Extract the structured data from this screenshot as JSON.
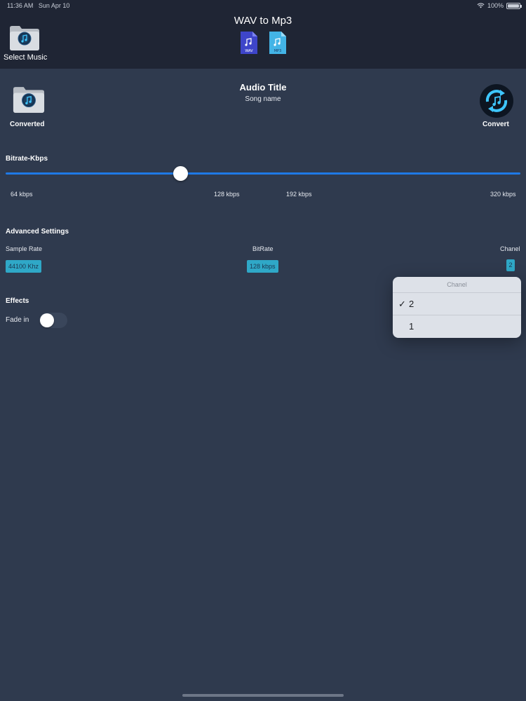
{
  "status_bar": {
    "time": "11:36 AM",
    "date": "Sun Apr 10",
    "battery": "100%",
    "wifi_icon": "wifi-icon",
    "battery_icon": "battery-icon"
  },
  "header": {
    "title": "WAV to Mp3",
    "select_music_label": "Select Music",
    "wav_icon_label": "WAV",
    "mp3_icon_label": "MP3"
  },
  "audio": {
    "title": "Audio Title",
    "song_name": "Song name"
  },
  "actions": {
    "converted_label": "Converted",
    "convert_label": "Convert"
  },
  "bitrate": {
    "title": "Bitrate-Kbps",
    "ticks": [
      "64 kbps",
      "128 kbps",
      "192 kbps",
      "320 kbps"
    ],
    "slider_fraction": 0.34
  },
  "advanced": {
    "title": "Advanced Settings",
    "sample_rate_label": "Sample Rate",
    "sample_rate_value": "44100 Khz",
    "bitrate_label": "BitRate",
    "bitrate_value": "128 kbps",
    "chanel_label": "Chanel",
    "chanel_value": "2"
  },
  "effects": {
    "title": "Effects",
    "fade_in_label": "Fade in",
    "fade_in_on": false
  },
  "chanel_menu": {
    "title": "Chanel",
    "options": [
      {
        "label": "2",
        "checked": true
      },
      {
        "label": "1",
        "checked": false
      }
    ],
    "check_mark": "✓"
  },
  "colors": {
    "background": "#2f3a4e",
    "header": "#1f2534",
    "accent_blue": "#1f79e6",
    "chip": "#2fa8c7"
  }
}
